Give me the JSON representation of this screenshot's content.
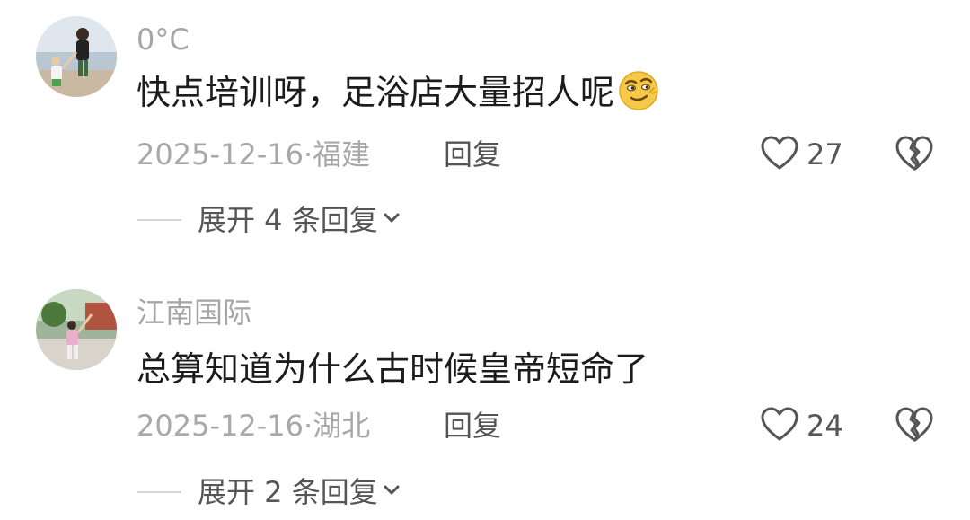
{
  "comments": [
    {
      "username": "0°C",
      "text": "快点培训呀，足浴店大量招人呢",
      "emoji_icon": "smirk-emoji-icon",
      "date": "2025-12-16",
      "location": "福建",
      "reply_label": "回复",
      "likes": "27",
      "expand_label": "展开 4 条回复",
      "reply_count": 4
    },
    {
      "username": "江南国际",
      "text": "总算知道为什么古时候皇帝短命了",
      "date": "2025-12-16",
      "location": "湖北",
      "reply_label": "回复",
      "likes": "24",
      "expand_label": "展开 2 条回复",
      "reply_count": 2
    }
  ],
  "icons": {
    "like": "heart-outline-icon",
    "dislike": "broken-heart-icon",
    "expand": "chevron-down-icon"
  },
  "colors": {
    "username": "#a6a6a6",
    "meta": "#a8a8a8",
    "action": "#555555",
    "text": "#1c1c1c"
  }
}
